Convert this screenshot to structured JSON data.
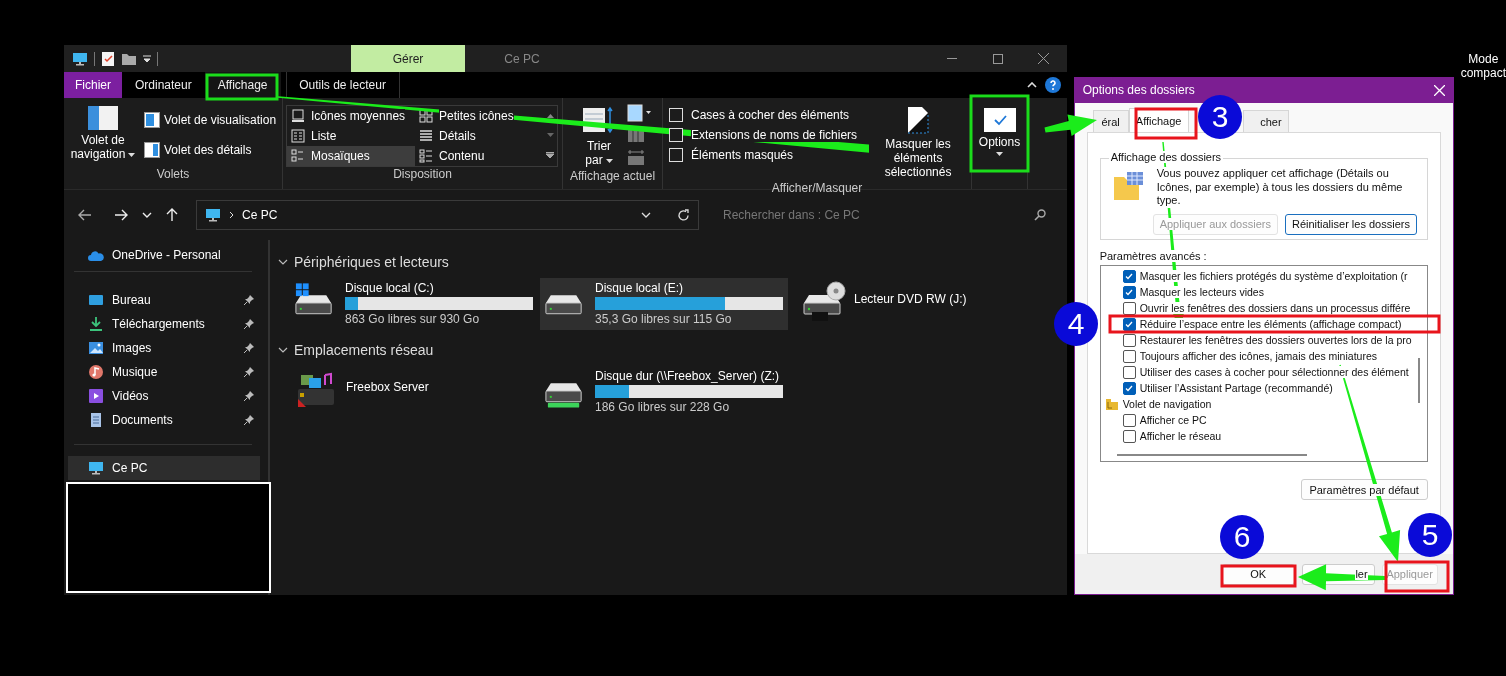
{
  "explorer": {
    "title_tabs": [
      {
        "label": "Gérer",
        "selected": true
      },
      {
        "label": "Ce PC",
        "selected": false
      }
    ],
    "file_tab": "Fichier",
    "ribbon_tabs": [
      {
        "label": "Ordinateur",
        "selected": false,
        "kind": "standard"
      },
      {
        "label": "Affichage",
        "selected": true,
        "kind": "standard"
      },
      {
        "label": "Outils de lecteur",
        "selected": false,
        "kind": "contextual"
      }
    ],
    "ribbon": {
      "panes": {
        "label": "Volets",
        "navigation_pane": "Volet de navigation",
        "items": [
          "Volet de visualisation",
          "Volet des détails"
        ]
      },
      "layout": {
        "label": "Disposition",
        "options": [
          {
            "label": "Icônes moyennes",
            "kind": "medium-icons",
            "selected": false
          },
          {
            "label": "Petites icônes",
            "kind": "small-icons",
            "selected": false
          },
          {
            "label": "Liste",
            "kind": "list",
            "selected": false
          },
          {
            "label": "Détails",
            "kind": "details",
            "selected": false
          },
          {
            "label": "Mosaïques",
            "kind": "tiles",
            "selected": true
          },
          {
            "label": "Contenu",
            "kind": "content",
            "selected": false
          }
        ]
      },
      "current_view": {
        "label": "Affichage actuel",
        "sort": "Trier par"
      },
      "show_hide": {
        "label": "Afficher/Masquer",
        "checkboxes": [
          {
            "label": "Cases à cocher des éléments",
            "checked": false
          },
          {
            "label": "Extensions de noms de fichiers",
            "checked": false
          },
          {
            "label": "Éléments masqués",
            "checked": false
          }
        ],
        "hide_selected": "Masquer les éléments sélectionnés"
      },
      "options": "Options"
    },
    "address": "Ce PC",
    "search_placeholder": "Rechercher dans : Ce PC",
    "sidebar": {
      "onedrive": "OneDrive - Personal",
      "quick_access": [
        {
          "label": "Bureau",
          "kind": "desktop",
          "pinned": true
        },
        {
          "label": "Téléchargements",
          "kind": "downloads",
          "pinned": true
        },
        {
          "label": "Images",
          "kind": "pictures",
          "pinned": true
        },
        {
          "label": "Musique",
          "kind": "music",
          "pinned": true
        },
        {
          "label": "Vidéos",
          "kind": "videos",
          "pinned": true
        },
        {
          "label": "Documents",
          "kind": "documents",
          "pinned": true
        }
      ],
      "this_pc": {
        "label": "Ce PC",
        "selected": true
      }
    },
    "sections": [
      {
        "title": "Périphériques et lecteurs",
        "expanded": true,
        "items": [
          {
            "kind": "system",
            "name": "Disque local (C:)",
            "level": 0.07,
            "info": "863 Go libres sur 930 Go",
            "selected": false
          },
          {
            "kind": "local",
            "name": "Disque local (E:)",
            "level": 0.69,
            "info": "35,3 Go libres sur 115 Go",
            "selected": true
          },
          {
            "kind": "dvd",
            "name": "Lecteur DVD RW (J:)",
            "selected": false
          }
        ]
      },
      {
        "title": "Emplacements réseau",
        "expanded": true,
        "items": [
          {
            "kind": "media-server",
            "name": "Freebox Server",
            "selected": false
          },
          {
            "kind": "network",
            "name": "Disque dur (\\\\Freebox_Server) (Z:)",
            "level": 0.18,
            "info": "186 Go libres sur 228 Go",
            "selected": false
          }
        ]
      }
    ]
  },
  "dialog": {
    "title": "Options des dossiers",
    "tabs": [
      {
        "label": "éral",
        "selected": false
      },
      {
        "label": "Affichage",
        "selected": true
      },
      {
        "label": "cher",
        "selected": false
      }
    ],
    "group_title": "Affichage des dossiers",
    "group_text": "Vous pouvez appliquer cet affichage (Détails ou Icônes, par exemple) à tous les dossiers du même type.",
    "group_buttons": [
      {
        "label": "Appliquer aux dossiers",
        "disabled": true
      },
      {
        "label": "Réinitialiser les dossiers",
        "disabled": false
      }
    ],
    "advanced_label": "Paramètres avancés :",
    "settings": [
      {
        "kind": "checkbox",
        "label": "Masquer les fichiers protégés du système d’exploitation (r",
        "checked": true
      },
      {
        "kind": "checkbox",
        "label": "Masquer les lecteurs vides",
        "checked": true
      },
      {
        "kind": "checkbox",
        "label": "Ouvrir les fenêtres des dossiers dans un processus différe",
        "checked": false
      },
      {
        "kind": "checkbox",
        "label": "Réduire l’espace entre les éléments (affichage compact)",
        "checked": true
      },
      {
        "kind": "checkbox",
        "label": "Restaurer les fenêtres des dossiers ouvertes lors de la pro",
        "checked": false
      },
      {
        "kind": "checkbox",
        "label": "Toujours afficher des icônes, jamais des miniatures",
        "checked": false
      },
      {
        "kind": "checkbox",
        "label": "Utiliser des cases à cocher pour sélectionner des élément",
        "checked": false
      },
      {
        "kind": "checkbox",
        "label": "Utiliser l’Assistant Partage (recommandé)",
        "checked": true
      },
      {
        "kind": "folder",
        "label": "Volet de navigation"
      },
      {
        "kind": "checkbox",
        "label": "Afficher ce PC",
        "checked": false
      },
      {
        "kind": "checkbox",
        "label": "Afficher le réseau",
        "checked": false
      }
    ],
    "restore_defaults": "Paramètres par défaut",
    "footer_buttons": [
      {
        "label": "OK",
        "disabled": false
      },
      {
        "label": "ler",
        "disabled": false
      },
      {
        "label": "Appliquer",
        "disabled": true
      }
    ]
  },
  "steps": [
    "3",
    "4",
    "5",
    "6"
  ],
  "corner_text": [
    "Mode",
    "compact"
  ]
}
